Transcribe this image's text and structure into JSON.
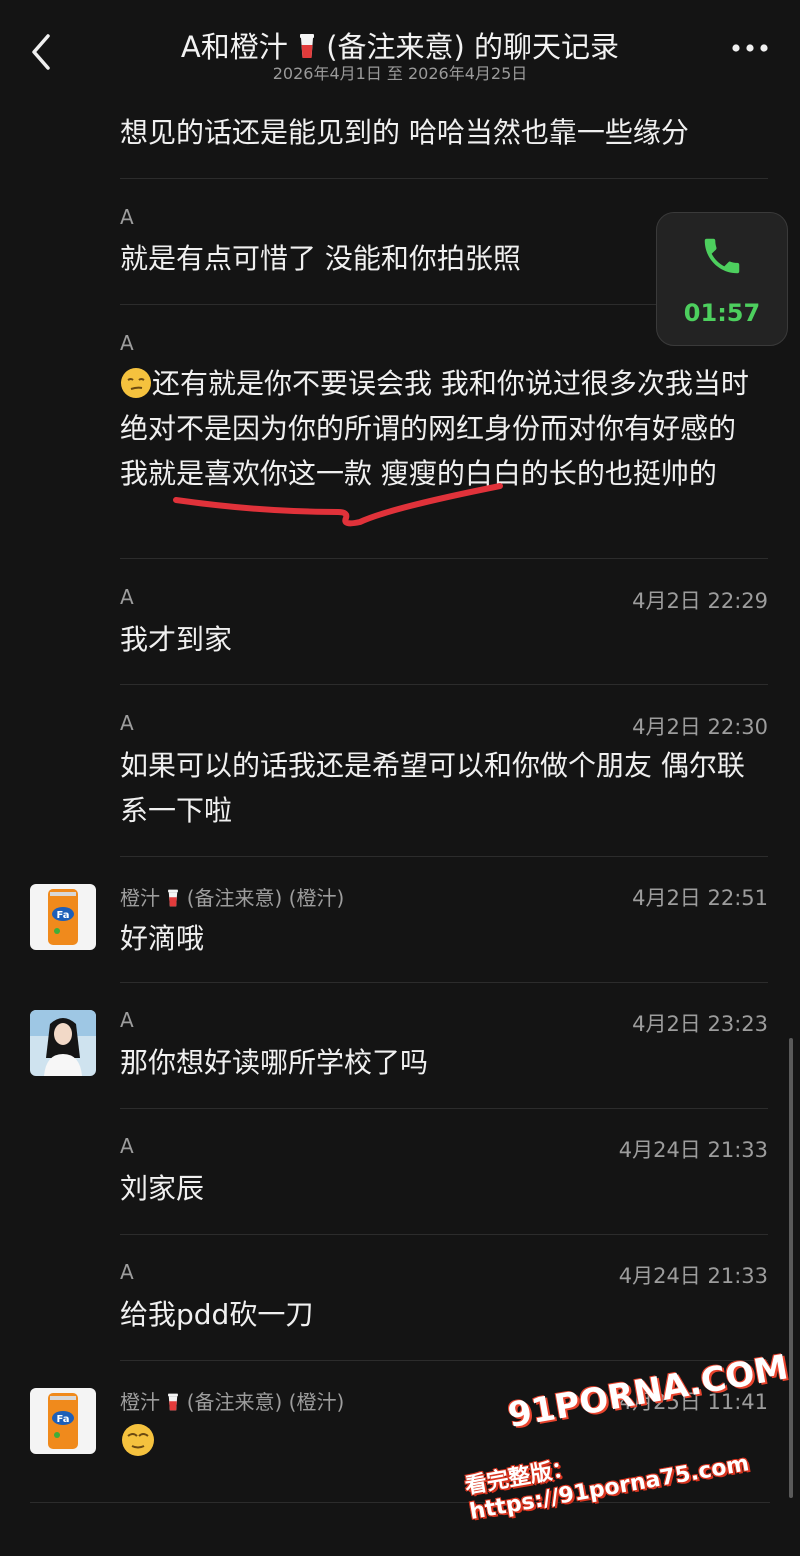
{
  "header": {
    "title": "A和橙汁",
    "title_tail": "(备注来意) 的聊天记录",
    "date_range": "2026年4月1日 至 2026年4月25日"
  },
  "call_widget": {
    "duration": "01:57",
    "icon": "phone-icon",
    "color": "#4dcf5e"
  },
  "messages": [
    {
      "text": "想见的话还是能见到的 哈哈当然也靠一些缘分"
    },
    {
      "sender": "A",
      "text": "就是有点可惜了 没能和你拍张照"
    },
    {
      "sender": "A",
      "text": "还有就是你不要误会我 我和你说过很多次我当时绝对不是因为你的所谓的网红身份而对你有好感的 我就是喜欢你这一款 瘦瘦的白白的长的也挺帅的",
      "emoji": "smirk-emoji"
    },
    {
      "sender": "A",
      "time": "4月2日 22:29",
      "text": "我才到家"
    },
    {
      "sender": "A",
      "time": "4月2日 22:30",
      "text": "如果可以的话我还是希望可以和你做个朋友 偶尔联系一下啦"
    },
    {
      "sender": "橙汁",
      "sender_tail": "(备注来意) (橙汁)",
      "time": "4月2日 22:51",
      "text": "好滴哦",
      "avatar": "fanta-can-avatar"
    },
    {
      "sender": "A",
      "time": "4月2日 23:23",
      "text": "那你想好读哪所学校了吗",
      "avatar": "girl-photo-avatar"
    },
    {
      "sender": "A",
      "time": "4月24日 21:33",
      "text": "刘家辰"
    },
    {
      "sender": "A",
      "time": "4月24日 21:33",
      "text": "给我pdd砍一刀"
    },
    {
      "sender": "橙汁",
      "sender_tail": "(备注来意) (橙汁)",
      "time": "4月25日 11:41",
      "emoji": "cool-face-emoji",
      "avatar": "fanta-can-avatar"
    }
  ],
  "watermark": {
    "brand": "PORNA.COM",
    "brand_prefix": "91",
    "line": "看完整版：https://91porna75.com"
  },
  "colors": {
    "background": "#141414",
    "text": "#f0f0f0",
    "meta": "#9d9d9d",
    "underline": "#e0323a",
    "separator": "#2c2c2c"
  }
}
